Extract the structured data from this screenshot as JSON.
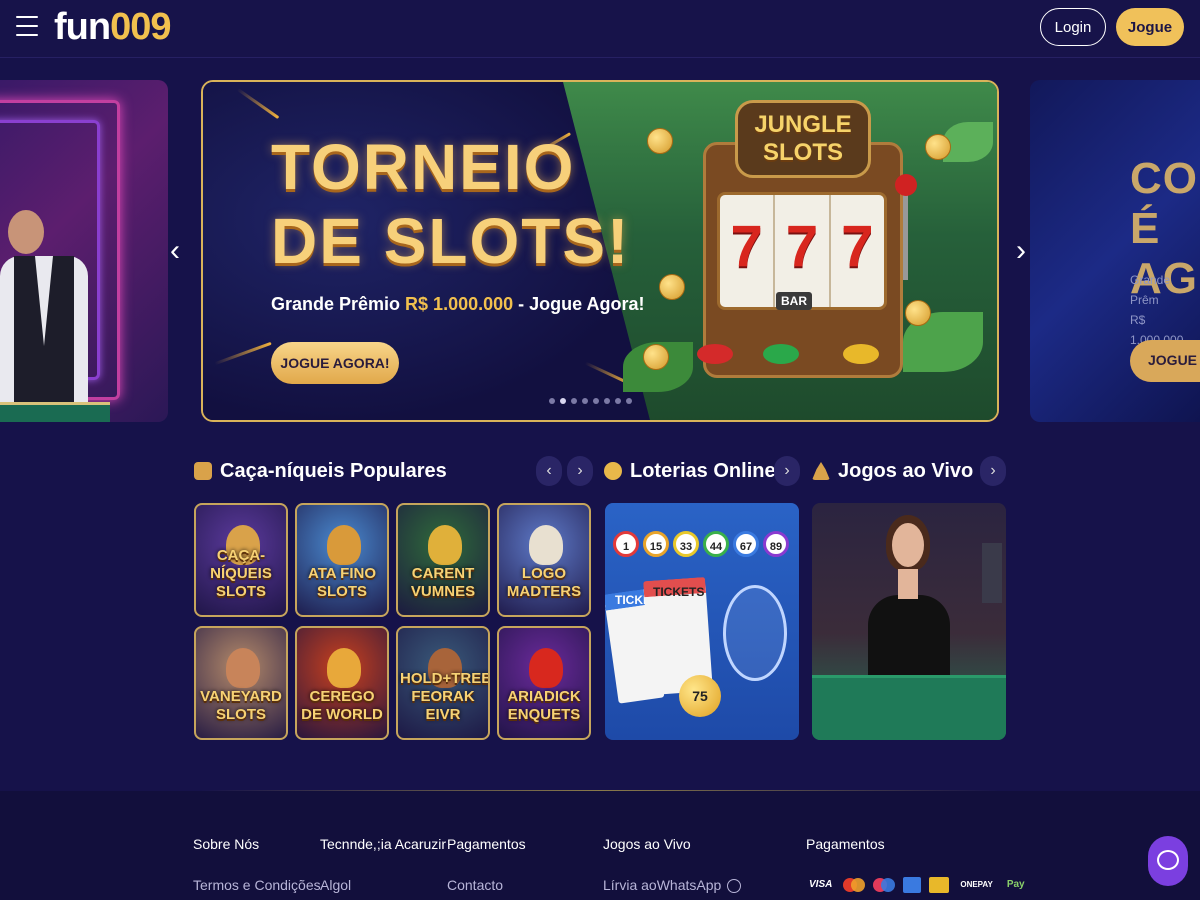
{
  "header": {
    "logo_white": "fun",
    "logo_gold": "009",
    "login_label": "Login",
    "jogue_label": "Jogue"
  },
  "carousel": {
    "main": {
      "title_line1": "TORNEIO",
      "title_line2": "DE SLOTS!",
      "subtitle_a": "Grande Prêmio ",
      "subtitle_b": "R$ 1.000.000",
      "subtitle_c": " - Jogue Agora!",
      "button": "JOGUE AGORA!",
      "machine_sign": "JUNGLE SLOTS",
      "reels": [
        "7",
        "7",
        "7"
      ],
      "bar_label": "BAR"
    },
    "right_peek": {
      "title_line1": "CON",
      "title_line2": "É AG",
      "sub_line1": "Grande Prêm",
      "sub_line2": "R$ 1.000.000",
      "button": "JOGUE A"
    },
    "prev_arrow": "‹",
    "next_arrow": "›",
    "dot_count": 8,
    "active_dot": 1
  },
  "sections": {
    "slots": {
      "title": "Caça-níqueis Populares",
      "icon": "slot-machine-icon",
      "prev": "‹",
      "next": "›",
      "tiles": [
        {
          "name": "CAÇA-NÍQUEIS SLOTS",
          "bg": "#5b3a9c",
          "figure": "#d9a24a"
        },
        {
          "name": "ATA FINO SLOTS",
          "bg": "#4a8ad0",
          "figure": "#d99a3a"
        },
        {
          "name": "CARENT VUMNES",
          "bg": "#2f6a3a",
          "figure": "#e0b03a"
        },
        {
          "name": "LOGO MADTERS",
          "bg": "#5e7ac8",
          "figure": "#e8e0d0"
        },
        {
          "name": "VANEYARD SLOTS",
          "bg": "#b48a6a",
          "figure": "#c8845a"
        },
        {
          "name": "CEREGO DE WORLD",
          "bg": "#c8401e",
          "figure": "#e8a83a"
        },
        {
          "name": "HOLD+TREBIS FEORAK EIVR",
          "bg": "#3a5a7a",
          "figure": "#a8643a"
        },
        {
          "name": "ARIADICK ENQUETS",
          "bg": "#6a2a9a",
          "figure": "#d8281e"
        }
      ]
    },
    "lottery": {
      "title": "Loterias Online",
      "icon": "lottery-ball-icon",
      "next": "›",
      "balls": [
        "1",
        "15",
        "33",
        "44",
        "67",
        "89"
      ],
      "ticket_labels": [
        "TICKE",
        "TICKETS"
      ],
      "big_ball": "75"
    },
    "live": {
      "title": "Jogos ao Vivo",
      "icon": "dealer-icon",
      "next": "›"
    }
  },
  "footer": {
    "columns": [
      {
        "head": "Sobre Nós",
        "link": "Termos e Condições"
      },
      {
        "head": "Tecnnde,;ia Acaruzir",
        "link": "Algol"
      },
      {
        "head": "Pagamentos",
        "link": "Contacto"
      },
      {
        "head": "Jogos ao Vivo",
        "link": "Lírvia aoWhatsApp"
      },
      {
        "head": "Pagamentos",
        "link": ""
      }
    ],
    "payments": [
      "VISA",
      "Mastercard",
      "Maestro",
      "AMEX",
      "Boleto",
      "ONEPAY",
      "Pay"
    ],
    "colors": {
      "accent": "#f0c15a",
      "chat": "#7b3fe0"
    }
  }
}
